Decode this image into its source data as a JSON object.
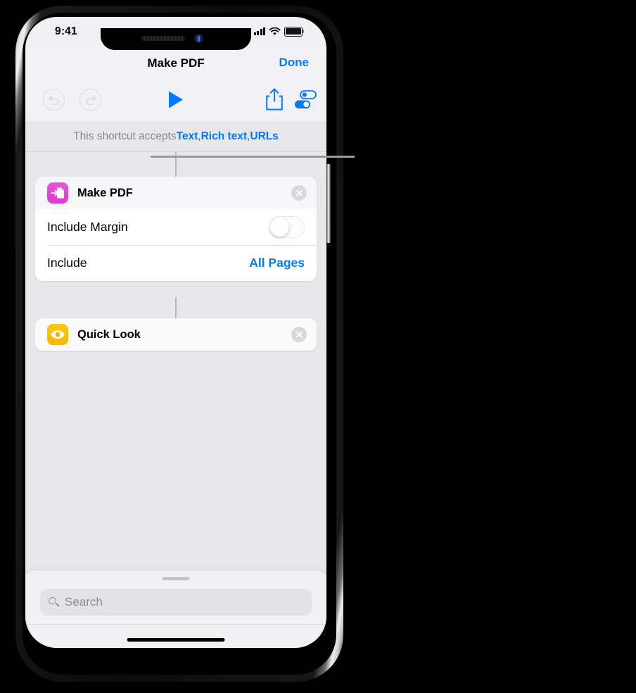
{
  "status_bar": {
    "time": "9:41",
    "cellular_icon": "signal-bars-icon",
    "wifi_icon": "wifi-icon",
    "battery_icon": "battery-full-icon"
  },
  "nav_bar": {
    "title": "Make PDF",
    "done_label": "Done"
  },
  "toolbar": {
    "undo_icon": "undo-icon",
    "redo_icon": "redo-icon",
    "play_icon": "play-icon",
    "share_icon": "share-icon",
    "settings_icon": "shortcut-settings-icon"
  },
  "accepts_banner": {
    "prefix": "This shortcut accepts ",
    "types": [
      "Text",
      "Rich text",
      "URLs"
    ],
    "separator": ", "
  },
  "actions": [
    {
      "title": "Make PDF",
      "icon": "make-pdf-icon",
      "icon_color": "#d93ad2",
      "close_icon": "close-icon",
      "parameters": [
        {
          "label": "Include Margin",
          "type": "toggle",
          "value": "off"
        },
        {
          "label": "Include",
          "type": "value",
          "value": "All Pages"
        }
      ]
    },
    {
      "title": "Quick Look",
      "icon": "quick-look-eye-icon",
      "icon_color": "#f5b700",
      "close_icon": "close-icon",
      "parameters": []
    }
  ],
  "bottom_sheet": {
    "grabber": "sheet-grabber",
    "search": {
      "placeholder": "Search",
      "value": "",
      "icon": "search-icon"
    }
  },
  "colors": {
    "accent_blue": "#007aff",
    "canvas_bg": "#e6e6eb",
    "bar_bg": "#f2f2f6",
    "card_bg": "#ffffff",
    "muted_text": "#8a8a8e"
  },
  "callout": {
    "name": "parameter-callout-line"
  }
}
